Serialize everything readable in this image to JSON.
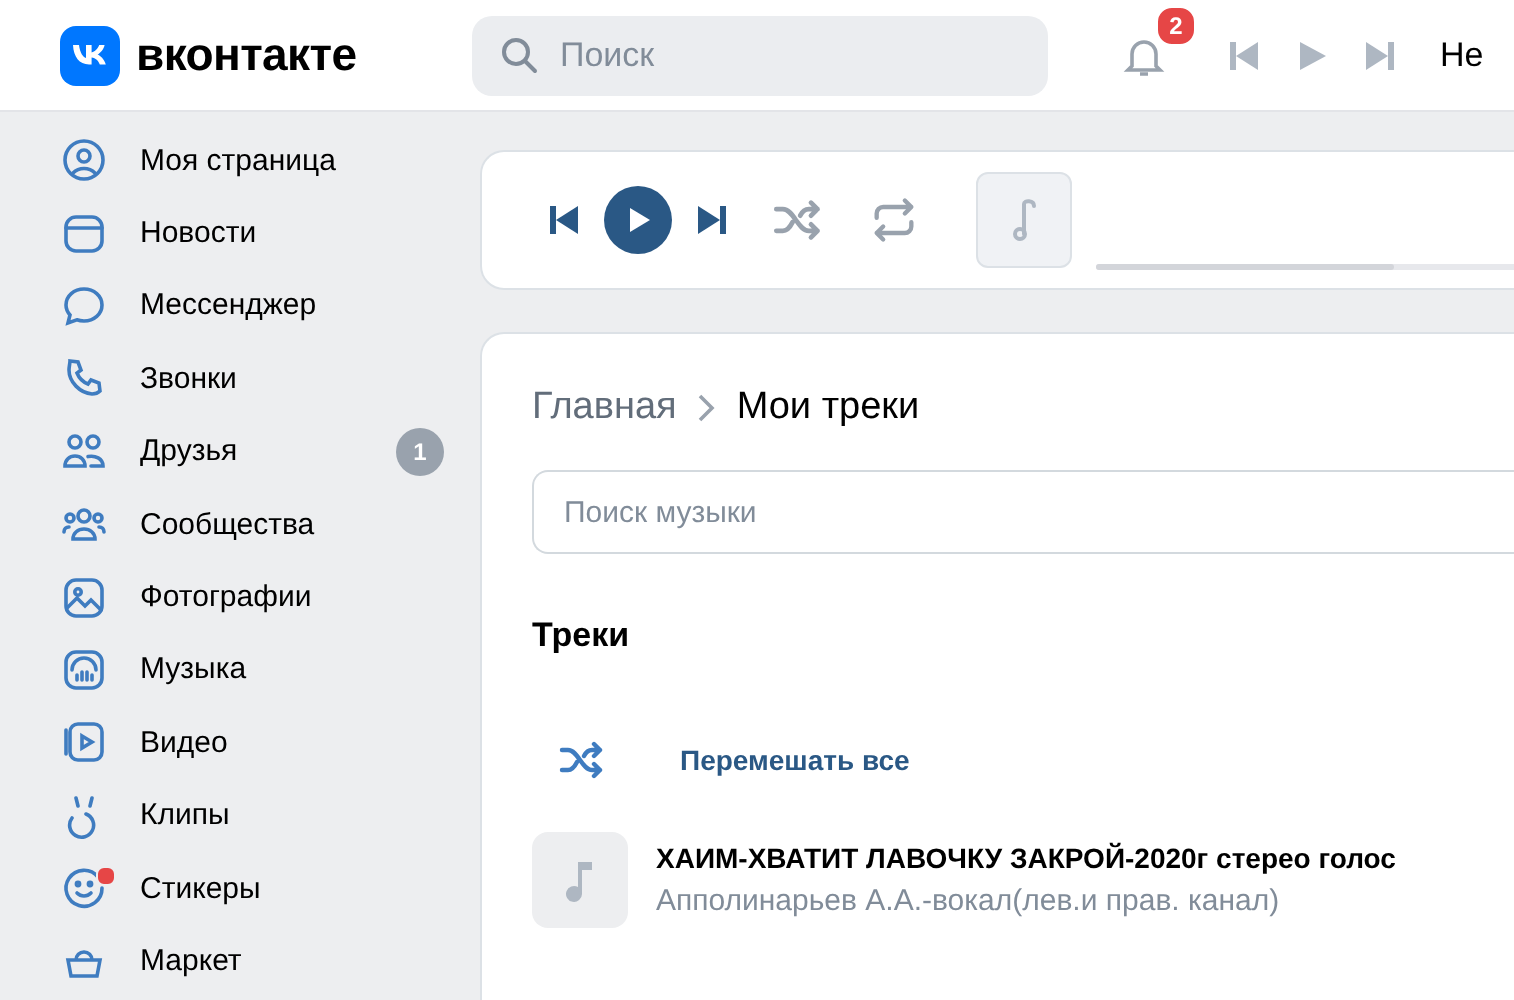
{
  "header": {
    "logo_text": "вконтакте",
    "search": {
      "placeholder": "Поиск"
    },
    "notifications_badge": "2",
    "user_name": "Не"
  },
  "sidebar": {
    "items": [
      {
        "label": "Моя страница",
        "dot": false
      },
      {
        "label": "Новости",
        "dot": false
      },
      {
        "label": "Мессенджер",
        "dot": false
      },
      {
        "label": "Звонки",
        "dot": false
      },
      {
        "label": "Друзья",
        "badge": "1",
        "dot": false
      },
      {
        "label": "Сообщества",
        "dot": false
      },
      {
        "label": "Фотографии",
        "dot": false
      },
      {
        "label": "Музыка",
        "dot": false
      },
      {
        "label": "Видео",
        "dot": false
      },
      {
        "label": "Клипы",
        "dot": false
      },
      {
        "label": "Стикеры",
        "dot": true
      },
      {
        "label": "Маркет",
        "dot": false
      }
    ]
  },
  "player": {
    "playing": false,
    "level": 0.59
  },
  "music": {
    "breadcrumb": [
      "Главная",
      "Мои треки"
    ],
    "search": {
      "placeholder": "Поиск музыки"
    },
    "section_title": "Треки",
    "shuffle_label": "Перемешать все",
    "tracks": [
      {
        "title": "ХАИМ-ХВАТИТ ЛАВОЧКУ ЗАКРОЙ-2020г стерео голос",
        "artist": "Апполинарьев А.А.-вокал(лев.и прав. канал)"
      }
    ]
  }
}
